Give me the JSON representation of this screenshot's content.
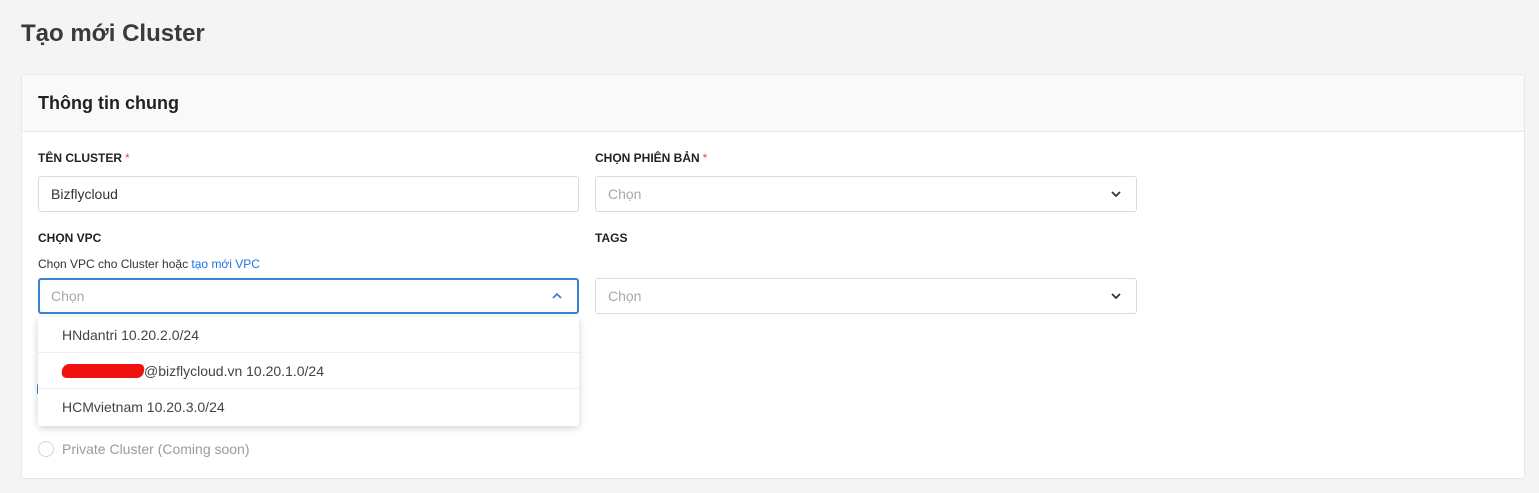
{
  "page": {
    "title": "Tạo mới Cluster"
  },
  "section": {
    "title": "Thông tin chung"
  },
  "cluster_name": {
    "label": "TÊN CLUSTER",
    "required_mark": "*",
    "value": "Bizflycloud"
  },
  "version": {
    "label": "CHỌN PHIÊN BẢN",
    "required_mark": "*",
    "placeholder": "Chọn"
  },
  "vpc": {
    "label": "CHỌN VPC",
    "hint_prefix": "Chọn VPC cho Cluster hoặc",
    "hint_link": "tạo mới VPC",
    "placeholder": "Chọn",
    "options": [
      {
        "label": "HNdantri 10.20.2.0/24",
        "redacted": false
      },
      {
        "label": "@bizflycloud.vn 10.20.1.0/24",
        "redacted": true
      },
      {
        "label": "HCMvietnam 10.20.3.0/24",
        "redacted": false
      }
    ]
  },
  "tags": {
    "label": "TAGS",
    "placeholder": "Chọn"
  },
  "cluster_type": {
    "private_label": "Private Cluster (Coming soon)"
  },
  "colors": {
    "accent": "#3b82d6",
    "link": "#1a73e8",
    "required": "#e74c3c",
    "redaction": "#f01010"
  }
}
